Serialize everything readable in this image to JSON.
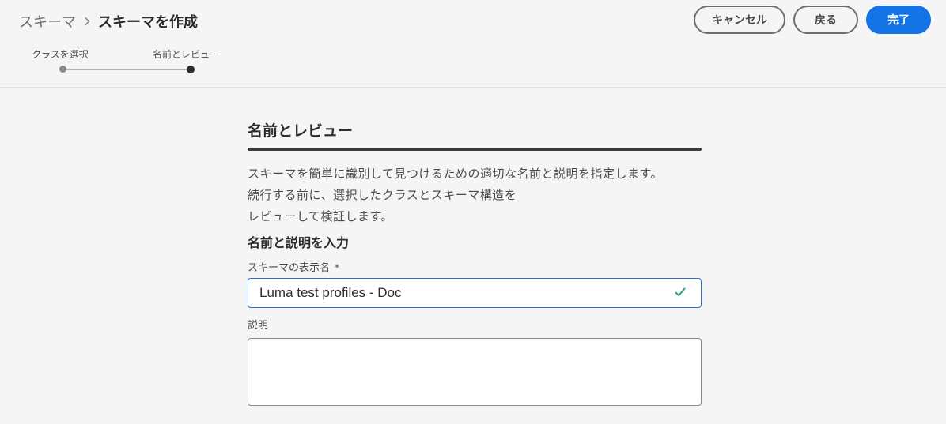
{
  "header": {
    "breadcrumb": {
      "parent": "スキーマ",
      "current": "スキーマを作成"
    },
    "actions": {
      "cancel_label": "キャンセル",
      "back_label": "戻る",
      "done_label": "完了"
    },
    "stepper": {
      "steps": [
        {
          "label": "クラスを選択",
          "state": "completed"
        },
        {
          "label": "名前とレビュー",
          "state": "current"
        }
      ]
    }
  },
  "main": {
    "section_title": "名前とレビュー",
    "description_lines": [
      "スキーマを簡単に識別して見つけるための適切な名前と説明を指定します。",
      "続行する前に、選択したクラスとスキーマ構造を",
      "レビューして検証します。"
    ],
    "subsection_title": "名前と説明を入力",
    "display_name": {
      "label": "スキーマの表示名",
      "required_marker": "*",
      "value": "Luma test profiles - Doc"
    },
    "description_field": {
      "label": "説明",
      "value": ""
    }
  },
  "colors": {
    "primary": "#1473e6",
    "valid": "#2d9d78",
    "focus_border": "#2c6ec8"
  },
  "icons": {
    "breadcrumb_separator": "chevron-right-icon",
    "valid": "checkmark-icon"
  }
}
